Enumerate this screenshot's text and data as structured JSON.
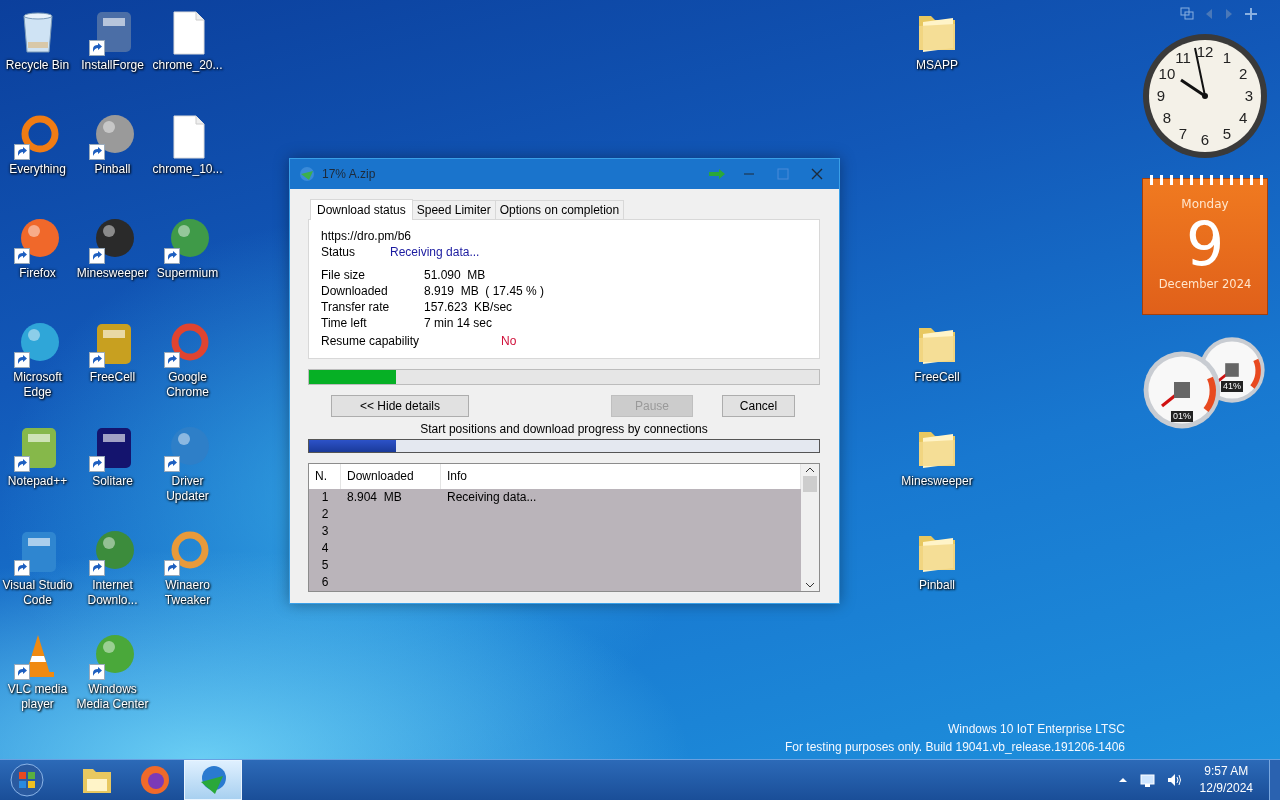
{
  "desktop_icons": [
    {
      "label": "Recycle Bin",
      "kind": "bin",
      "shortcut": false
    },
    {
      "label": "InstallForge",
      "kind": "app",
      "color": "#4b6ea6",
      "shortcut": true
    },
    {
      "label": "chrome_20...",
      "kind": "file",
      "shortcut": false
    },
    {
      "label": "Everything",
      "kind": "ring",
      "color": "#f07c14",
      "shortcut": true
    },
    {
      "label": "Pinball",
      "kind": "ball",
      "color": "#9a9a9a",
      "shortcut": true
    },
    {
      "label": "chrome_10...",
      "kind": "file",
      "shortcut": false
    },
    {
      "label": "Firefox",
      "kind": "ball",
      "color": "#f0682a",
      "shortcut": true
    },
    {
      "label": "Minesweeper",
      "kind": "ball",
      "color": "#2a2a2a",
      "shortcut": true
    },
    {
      "label": "Supermium",
      "kind": "ball",
      "color": "#3f9a48",
      "shortcut": true
    },
    {
      "label": "Microsoft Edge",
      "kind": "ball",
      "color": "#2fa6d8",
      "shortcut": true
    },
    {
      "label": "FreeCell",
      "kind": "app",
      "color": "#c8a020",
      "shortcut": true
    },
    {
      "label": "Google Chrome",
      "kind": "ring",
      "color": "#e04430",
      "shortcut": true
    },
    {
      "label": "Notepad++",
      "kind": "app",
      "color": "#86b84a",
      "shortcut": true
    },
    {
      "label": "Solitare",
      "kind": "app",
      "color": "#14146e",
      "shortcut": true
    },
    {
      "label": "Driver Updater",
      "kind": "ball",
      "color": "#2e7fc8",
      "shortcut": true
    },
    {
      "label": "Visual Studio Code",
      "kind": "app",
      "color": "#2f86d0",
      "shortcut": true
    },
    {
      "label": "Internet Downlo...",
      "kind": "ball",
      "color": "#3c8c3c",
      "shortcut": true
    },
    {
      "label": "Winaero Tweaker",
      "kind": "ring",
      "color": "#e89a3a",
      "shortcut": true
    },
    {
      "label": "VLC media player",
      "kind": "cone",
      "color": "#f08a10",
      "shortcut": true
    },
    {
      "label": "Windows Media Center",
      "kind": "ball",
      "color": "#4aa83a",
      "shortcut": true
    }
  ],
  "right_icons": [
    {
      "label": "MSAPP"
    },
    {
      "label": "FreeCell"
    },
    {
      "label": "Minesweeper"
    },
    {
      "label": "Pinball"
    }
  ],
  "dialog": {
    "title": "17% A.zip",
    "tabs": [
      {
        "label": "Download status",
        "selected": true
      },
      {
        "label": "Speed Limiter",
        "selected": false
      },
      {
        "label": "Options on completion",
        "selected": false
      }
    ],
    "url": "https://dro.pm/b6",
    "rows": [
      {
        "kind": "status",
        "label": "Status",
        "value": "Receiving data..."
      },
      {
        "kind": "field",
        "label": "File size",
        "value": "51.090  MB"
      },
      {
        "kind": "field",
        "label": "Downloaded",
        "value": "8.919  MB  ( 17.45 % )"
      },
      {
        "kind": "field",
        "label": "Transfer rate",
        "value": "157.623  KB/sec"
      },
      {
        "kind": "field",
        "label": "Time left",
        "value": "7 min 14 sec"
      },
      {
        "kind": "flag",
        "label": "Resume capability",
        "value": "No"
      }
    ],
    "progress": {
      "level": 0.17
    },
    "buttons": [
      {
        "label": "<< Hide details",
        "disabled": false
      },
      {
        "label": "Pause",
        "disabled": true
      },
      {
        "label": "Cancel",
        "disabled": false
      }
    ],
    "connections_caption": "Start positions and download progress by connections",
    "connections_bar": {
      "level": 0.17
    },
    "table": {
      "columns": [
        "N.",
        "Downloaded",
        "Info"
      ],
      "rows": [
        {
          "n": "1",
          "downloaded": "8.904  MB",
          "info": "Receiving data..."
        },
        {
          "n": "2"
        },
        {
          "n": "3"
        },
        {
          "n": "4"
        },
        {
          "n": "5"
        },
        {
          "n": "6"
        }
      ]
    }
  },
  "gadgets": {
    "clock": {
      "numerals": [
        "11",
        "12",
        "1",
        "10",
        "2",
        "9",
        "3",
        "8",
        "4",
        "7",
        "6",
        "5"
      ]
    },
    "calendar": {
      "weekday": "Monday",
      "day": "9",
      "month_year": "December 2024"
    },
    "meters": [
      {
        "reading": "01%"
      },
      {
        "reading": "41%"
      }
    ]
  },
  "os_notice": [
    "Windows 10 IoT Enterprise LTSC",
    "For testing purposes only. Build 19041.vb_release.191206-1406"
  ],
  "taskbar": {
    "buttons": [
      {
        "kind": "start",
        "selected": false
      },
      {
        "kind": "explorer",
        "selected": false
      },
      {
        "kind": "firefox",
        "selected": false
      },
      {
        "kind": "idm",
        "selected": true
      }
    ],
    "time": "9:57 AM",
    "date": "12/9/2024"
  }
}
